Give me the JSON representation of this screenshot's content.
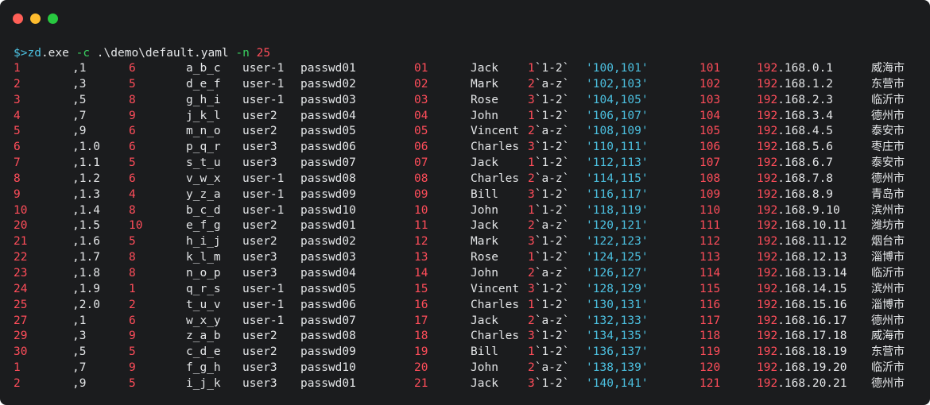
{
  "window": {
    "buttons": {
      "close": "close",
      "minimize": "minimize",
      "zoom": "zoom"
    }
  },
  "command": {
    "prompt": "$>",
    "exe": "zd",
    "ext": ".exe",
    "flag_c": "-c",
    "config_path": ".\\demo\\default.yaml",
    "flag_n": "-n",
    "count": "25"
  },
  "rows": [
    {
      "c1": "1",
      "c2": ",1",
      "c3": "6",
      "c4": "a_b_c",
      "c5": "user-1",
      "c6": "passwd01",
      "c7": "01",
      "c8": "Jack",
      "c9n": "1",
      "c9": "`1-2`",
      "c10": "'100,101'",
      "c11": "101",
      "c12n": "192",
      "c12": ".168.0.1",
      "c13": "威海市"
    },
    {
      "c1": "2",
      "c2": ",3",
      "c3": "5",
      "c4": "d_e_f",
      "c5": "user-1",
      "c6": "passwd02",
      "c7": "02",
      "c8": "Mark",
      "c9n": "2",
      "c9": "`a-z`",
      "c10": "'102,103'",
      "c11": "102",
      "c12n": "192",
      "c12": ".168.1.2",
      "c13": "东营市"
    },
    {
      "c1": "3",
      "c2": ",5",
      "c3": "8",
      "c4": "g_h_i",
      "c5": "user-1",
      "c6": "passwd03",
      "c7": "03",
      "c8": "Rose",
      "c9n": "3",
      "c9": "`1-2`",
      "c10": "'104,105'",
      "c11": "103",
      "c12n": "192",
      "c12": ".168.2.3",
      "c13": "临沂市"
    },
    {
      "c1": "4",
      "c2": ",7",
      "c3": "9",
      "c4": "j_k_l",
      "c5": "user2",
      "c6": "passwd04",
      "c7": "04",
      "c8": "John",
      "c9n": "1",
      "c9": "`1-2`",
      "c10": "'106,107'",
      "c11": "104",
      "c12n": "192",
      "c12": ".168.3.4",
      "c13": "德州市"
    },
    {
      "c1": "5",
      "c2": ",9",
      "c3": "6",
      "c4": "m_n_o",
      "c5": "user2",
      "c6": "passwd05",
      "c7": "05",
      "c8": "Vincent",
      "c9n": "2",
      "c9": "`a-z`",
      "c10": "'108,109'",
      "c11": "105",
      "c12n": "192",
      "c12": ".168.4.5",
      "c13": "泰安市"
    },
    {
      "c1": "6",
      "c2": ",1.0",
      "c3": "6",
      "c4": "p_q_r",
      "c5": "user3",
      "c6": "passwd06",
      "c7": "06",
      "c8": "Charles",
      "c9n": "3",
      "c9": "`1-2`",
      "c10": "'110,111'",
      "c11": "106",
      "c12n": "192",
      "c12": ".168.5.6",
      "c13": "枣庄市"
    },
    {
      "c1": "7",
      "c2": ",1.1",
      "c3": "5",
      "c4": "s_t_u",
      "c5": "user3",
      "c6": "passwd07",
      "c7": "07",
      "c8": "Jack",
      "c9n": "1",
      "c9": "`1-2`",
      "c10": "'112,113'",
      "c11": "107",
      "c12n": "192",
      "c12": ".168.6.7",
      "c13": "泰安市"
    },
    {
      "c1": "8",
      "c2": ",1.2",
      "c3": "6",
      "c4": "v_w_x",
      "c5": "user-1",
      "c6": "passwd08",
      "c7": "08",
      "c8": "Charles",
      "c9n": "2",
      "c9": "`a-z`",
      "c10": "'114,115'",
      "c11": "108",
      "c12n": "192",
      "c12": ".168.7.8",
      "c13": "德州市"
    },
    {
      "c1": "9",
      "c2": ",1.3",
      "c3": "4",
      "c4": "y_z_a",
      "c5": "user-1",
      "c6": "passwd09",
      "c7": "09",
      "c8": "Bill",
      "c9n": "3",
      "c9": "`1-2`",
      "c10": "'116,117'",
      "c11": "109",
      "c12n": "192",
      "c12": ".168.8.9",
      "c13": "青岛市"
    },
    {
      "c1": "10",
      "c2": ",1.4",
      "c3": "8",
      "c4": "b_c_d",
      "c5": "user-1",
      "c6": "passwd10",
      "c7": "10",
      "c8": "John",
      "c9n": "1",
      "c9": "`1-2`",
      "c10": "'118,119'",
      "c11": "110",
      "c12n": "192",
      "c12": ".168.9.10",
      "c13": "滨州市"
    },
    {
      "c1": "20",
      "c2": ",1.5",
      "c3": "10",
      "c4": "e_f_g",
      "c5": "user2",
      "c6": "passwd01",
      "c7": "11",
      "c8": "Jack",
      "c9n": "2",
      "c9": "`a-z`",
      "c10": "'120,121'",
      "c11": "111",
      "c12n": "192",
      "c12": ".168.10.11",
      "c13": "潍坊市"
    },
    {
      "c1": "21",
      "c2": ",1.6",
      "c3": "5",
      "c4": "h_i_j",
      "c5": "user2",
      "c6": "passwd02",
      "c7": "12",
      "c8": "Mark",
      "c9n": "3",
      "c9": "`1-2`",
      "c10": "'122,123'",
      "c11": "112",
      "c12n": "192",
      "c12": ".168.11.12",
      "c13": "烟台市"
    },
    {
      "c1": "22",
      "c2": ",1.7",
      "c3": "8",
      "c4": "k_l_m",
      "c5": "user3",
      "c6": "passwd03",
      "c7": "13",
      "c8": "Rose",
      "c9n": "1",
      "c9": "`1-2`",
      "c10": "'124,125'",
      "c11": "113",
      "c12n": "192",
      "c12": ".168.12.13",
      "c13": "淄博市"
    },
    {
      "c1": "23",
      "c2": ",1.8",
      "c3": "8",
      "c4": "n_o_p",
      "c5": "user3",
      "c6": "passwd04",
      "c7": "14",
      "c8": "John",
      "c9n": "2",
      "c9": "`a-z`",
      "c10": "'126,127'",
      "c11": "114",
      "c12n": "192",
      "c12": ".168.13.14",
      "c13": "临沂市"
    },
    {
      "c1": "24",
      "c2": ",1.9",
      "c3": "1",
      "c4": "q_r_s",
      "c5": "user-1",
      "c6": "passwd05",
      "c7": "15",
      "c8": "Vincent",
      "c9n": "3",
      "c9": "`1-2`",
      "c10": "'128,129'",
      "c11": "115",
      "c12n": "192",
      "c12": ".168.14.15",
      "c13": "滨州市"
    },
    {
      "c1": "25",
      "c2": ",2.0",
      "c3": "2",
      "c4": "t_u_v",
      "c5": "user-1",
      "c6": "passwd06",
      "c7": "16",
      "c8": "Charles",
      "c9n": "1",
      "c9": "`1-2`",
      "c10": "'130,131'",
      "c11": "116",
      "c12n": "192",
      "c12": ".168.15.16",
      "c13": "淄博市"
    },
    {
      "c1": "27",
      "c2": ",1",
      "c3": "6",
      "c4": "w_x_y",
      "c5": "user-1",
      "c6": "passwd07",
      "c7": "17",
      "c8": "Jack",
      "c9n": "2",
      "c9": "`a-z`",
      "c10": "'132,133'",
      "c11": "117",
      "c12n": "192",
      "c12": ".168.16.17",
      "c13": "德州市"
    },
    {
      "c1": "29",
      "c2": ",3",
      "c3": "9",
      "c4": "z_a_b",
      "c5": "user2",
      "c6": "passwd08",
      "c7": "18",
      "c8": "Charles",
      "c9n": "3",
      "c9": "`1-2`",
      "c10": "'134,135'",
      "c11": "118",
      "c12n": "192",
      "c12": ".168.17.18",
      "c13": "威海市"
    },
    {
      "c1": "30",
      "c2": ",5",
      "c3": "5",
      "c4": "c_d_e",
      "c5": "user2",
      "c6": "passwd09",
      "c7": "19",
      "c8": "Bill",
      "c9n": "1",
      "c9": "`1-2`",
      "c10": "'136,137'",
      "c11": "119",
      "c12n": "192",
      "c12": ".168.18.19",
      "c13": "东营市"
    },
    {
      "c1": "1",
      "c2": ",7",
      "c3": "9",
      "c4": "f_g_h",
      "c5": "user3",
      "c6": "passwd10",
      "c7": "20",
      "c8": "John",
      "c9n": "2",
      "c9": "`a-z`",
      "c10": "'138,139'",
      "c11": "120",
      "c12n": "192",
      "c12": ".168.19.20",
      "c13": "临沂市"
    },
    {
      "c1": "2",
      "c2": ",9",
      "c3": "5",
      "c4": "i_j_k",
      "c5": "user3",
      "c6": "passwd01",
      "c7": "21",
      "c8": "Jack",
      "c9n": "3",
      "c9": "`1-2`",
      "c10": "'140,141'",
      "c11": "121",
      "c12n": "192",
      "c12": ".168.20.21",
      "c13": "德州市"
    }
  ],
  "colors": {
    "background": "#1b1c1e",
    "number": "#ff4d5a",
    "string": "#4cc0e0",
    "prompt": "#3ad160",
    "text": "#e4e6e8"
  }
}
